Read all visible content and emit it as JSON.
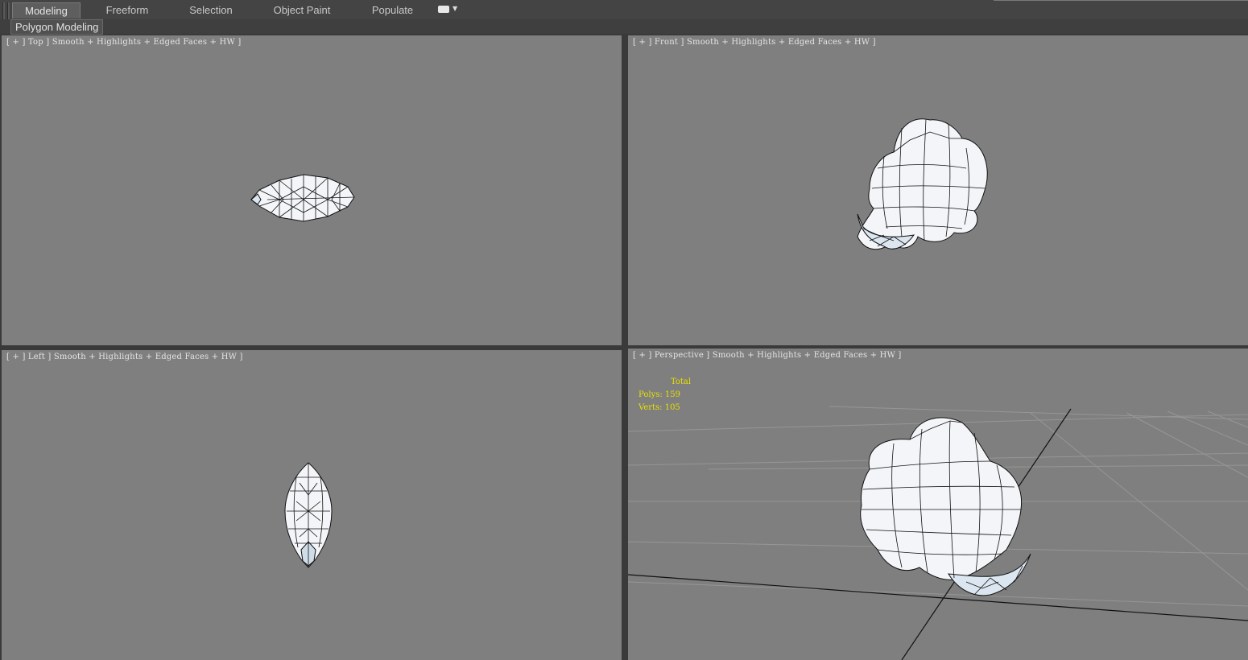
{
  "ribbon": {
    "tabs": [
      {
        "label": "Modeling",
        "active": true
      },
      {
        "label": "Freeform",
        "active": false
      },
      {
        "label": "Selection",
        "active": false
      },
      {
        "label": "Object Paint",
        "active": false
      },
      {
        "label": "Populate",
        "active": false
      }
    ],
    "more_icon": "ribbon-options-icon"
  },
  "panel": {
    "label": "Polygon Modeling"
  },
  "viewports": {
    "top": {
      "label": "[ + ] Top ] Smooth + Highlights + Edged Faces + HW ]"
    },
    "front": {
      "label": "[ + ] Front ] Smooth + Highlights + Edged Faces + HW ]"
    },
    "left": {
      "label": "[ + ] Left ] Smooth + Highlights + Edged Faces + HW ]"
    },
    "perspective": {
      "label": "[ + ] Perspective ] Smooth + Highlights + Edged Faces + HW ]",
      "stats": {
        "header": "Total",
        "polys": "Polys: 159",
        "verts": "Verts: 105"
      }
    }
  },
  "colors": {
    "viewport_bg": "#7f7f7f",
    "stats_text": "#e8e000",
    "mesh_fill": "#f3f5f8",
    "mesh_edge": "#111111"
  }
}
